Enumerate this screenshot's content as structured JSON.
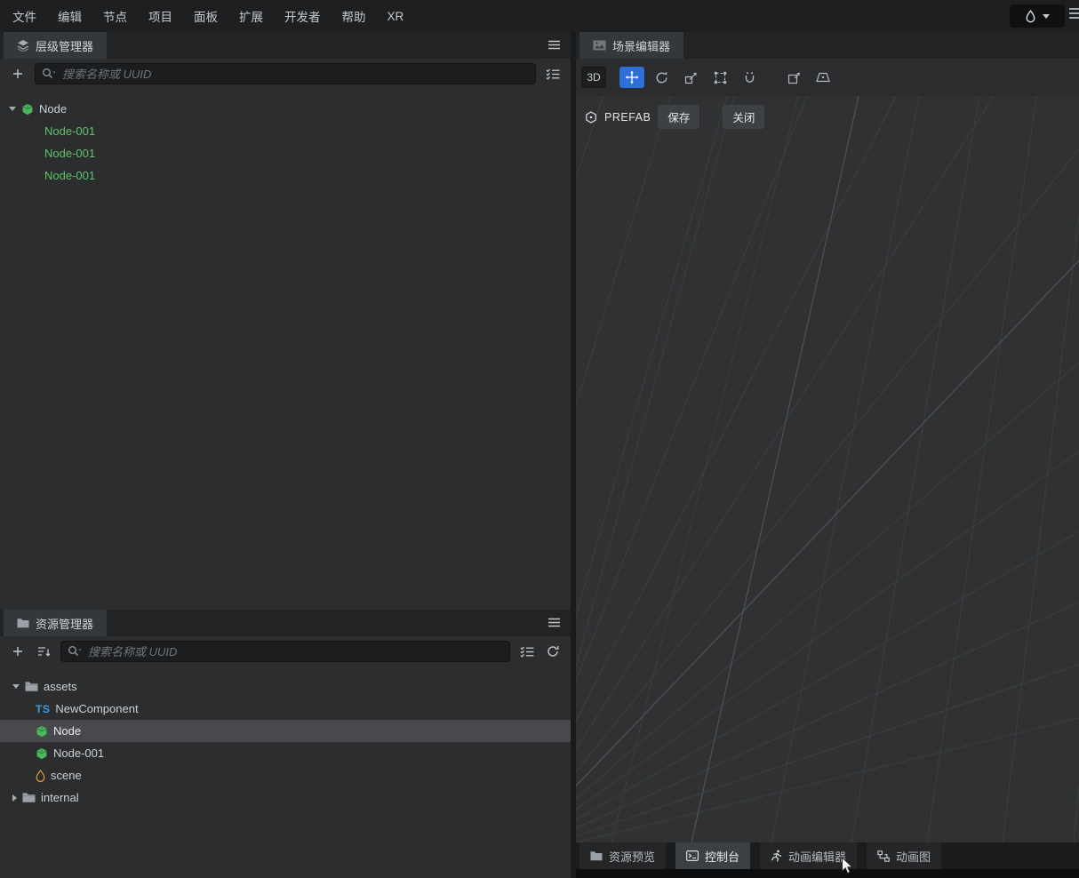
{
  "menu": {
    "items": [
      "文件",
      "编辑",
      "节点",
      "项目",
      "面板",
      "扩展",
      "开发者",
      "帮助",
      "XR"
    ]
  },
  "hierarchy": {
    "tab_label": "层级管理器",
    "search_placeholder": "搜索名称或 UUID",
    "root_label": "Node",
    "children": [
      "Node-001",
      "Node-001",
      "Node-001"
    ]
  },
  "assets": {
    "tab_label": "资源管理器",
    "search_placeholder": "搜索名称或 UUID",
    "ts_badge": "TS",
    "items": [
      {
        "label": "assets"
      },
      {
        "label": "NewComponent"
      },
      {
        "label": "Node"
      },
      {
        "label": "Node-001"
      },
      {
        "label": "scene"
      },
      {
        "label": "internal"
      }
    ]
  },
  "scene": {
    "tab_label": "场景编辑器",
    "mode_label": "3D",
    "prefab": {
      "label": "PREFAB",
      "save_label": "保存",
      "close_label": "关闭"
    }
  },
  "bottom_tabs": [
    {
      "label": "资源预览",
      "active": false
    },
    {
      "label": "控制台",
      "active": true
    },
    {
      "label": "动画编辑器",
      "active": false
    },
    {
      "label": "动画图",
      "active": false
    }
  ],
  "colors": {
    "accent_blue": "#2e6fd9",
    "node_green": "#5ec46a",
    "scene_orange": "#d4983c",
    "ts_blue": "#3f9ae0",
    "selection_bg": "#47494c",
    "viewport_bg": "#2f3133",
    "grid_line": "#3c3f41"
  }
}
